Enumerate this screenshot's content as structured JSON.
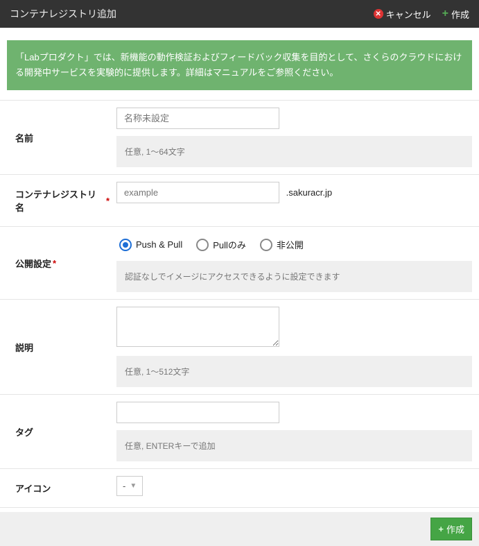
{
  "header": {
    "title": "コンテナレジストリ追加",
    "cancel_label": "キャンセル",
    "create_label": "作成"
  },
  "notice": "「Labプロダクト」では、新機能の動作検証およびフィードバック収集を目的として、さくらのクラウドにおける開発中サービスを実験的に提供します。詳細はマニュアルをご参照ください。",
  "fields": {
    "name": {
      "label": "名前",
      "placeholder": "名称未設定",
      "hint": "任意, 1〜64文字"
    },
    "registry_name": {
      "label": "コンテナレジストリ名",
      "placeholder": "example",
      "suffix": ".sakuracr.jp"
    },
    "visibility": {
      "label": "公開設定",
      "options": [
        {
          "label": "Push & Pull",
          "selected": true
        },
        {
          "label": "Pullのみ",
          "selected": false
        },
        {
          "label": "非公開",
          "selected": false
        }
      ],
      "hint": "認証なしでイメージにアクセスできるように設定できます"
    },
    "description": {
      "label": "説明",
      "hint": "任意, 1〜512文字"
    },
    "tag": {
      "label": "タグ",
      "hint": "任意, ENTERキーで追加"
    },
    "icon": {
      "label": "アイコン",
      "value": "-"
    }
  },
  "footer": {
    "create_label": "作成"
  }
}
